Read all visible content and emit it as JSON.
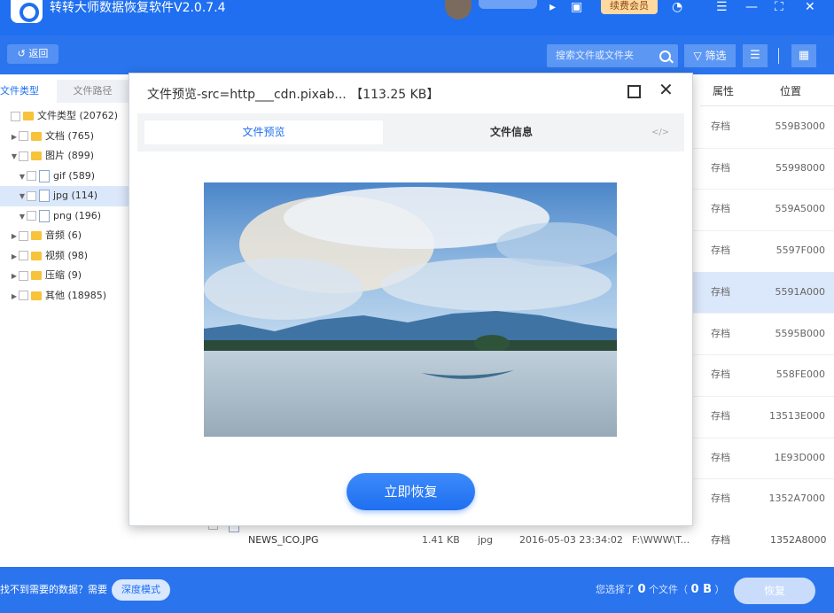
{
  "app": {
    "title": "转转大师数据恢复软件V2.0.7.4",
    "vip_label": "续费会员"
  },
  "toolbar": {
    "back_label": "返回",
    "search_placeholder": "搜索文件或文件夹",
    "filter_label": "筛选"
  },
  "left_panel": {
    "tabs": [
      "文件类型",
      "文件路径"
    ],
    "tree": [
      {
        "label": "文件类型 (20762)",
        "depth": 0,
        "type": "folder",
        "arrow": ""
      },
      {
        "label": "文档 (765)",
        "depth": 1,
        "type": "folder",
        "arrow": "▶"
      },
      {
        "label": "图片 (899)",
        "depth": 1,
        "type": "folder",
        "arrow": "▼"
      },
      {
        "label": "gif (589)",
        "depth": 2,
        "type": "image",
        "arrow": "▼"
      },
      {
        "label": "jpg (114)",
        "depth": 2,
        "type": "image",
        "arrow": "▼",
        "selected": true
      },
      {
        "label": "png (196)",
        "depth": 2,
        "type": "image",
        "arrow": "▼"
      },
      {
        "label": "音频 (6)",
        "depth": 1,
        "type": "folder",
        "arrow": "▶"
      },
      {
        "label": "视频 (98)",
        "depth": 1,
        "type": "folder",
        "arrow": "▶"
      },
      {
        "label": "压缩 (9)",
        "depth": 1,
        "type": "folder",
        "arrow": "▶"
      },
      {
        "label": "其他 (18985)",
        "depth": 1,
        "type": "folder",
        "arrow": "▶"
      }
    ]
  },
  "table": {
    "headers": {
      "attr": "属性",
      "position": "位置"
    },
    "rows": [
      {
        "attr": "存档",
        "position": "559B3000"
      },
      {
        "attr": "存档",
        "position": "55998000"
      },
      {
        "attr": "存档",
        "position": "559A5000"
      },
      {
        "attr": "存档",
        "position": "5597F000"
      },
      {
        "attr": "存档",
        "position": "5591A000",
        "selected": true
      },
      {
        "attr": "存档",
        "position": "5595B000"
      },
      {
        "attr": "存档",
        "position": "558FE000"
      },
      {
        "attr": "存档",
        "position": "13513E000"
      },
      {
        "attr": "存档",
        "position": "1E93D000"
      },
      {
        "attr": "存档",
        "position": "1352A7000"
      }
    ],
    "last_row": {
      "name": "NEWS_ICO.JPG",
      "size": "1.41 KB",
      "ext": "jpg",
      "date": "2016-05-03 23:34:02",
      "path": "F:\\WWW\\T...",
      "attr": "存档",
      "position": "1352A8000"
    }
  },
  "bottom": {
    "hint": "找不到需要的数据？需要",
    "deep_mode": "深度模式",
    "selected_prefix": "您选择了",
    "selected_count": "0",
    "selected_mid": "个文件（",
    "selected_size": "0 B",
    "selected_suffix": "）",
    "recover_label": "恢复"
  },
  "dialog": {
    "title": "文件预览-src=http___cdn.pixab... 【113.25 KB】",
    "tab_preview": "文件预览",
    "tab_info": "文件信息",
    "code_icon": "</>",
    "recover_label": "立即恢复"
  },
  "colors": {
    "primary": "#1f6ff0",
    "toolbar": "#2a74ee",
    "selected_row": "#dbe8fb"
  }
}
